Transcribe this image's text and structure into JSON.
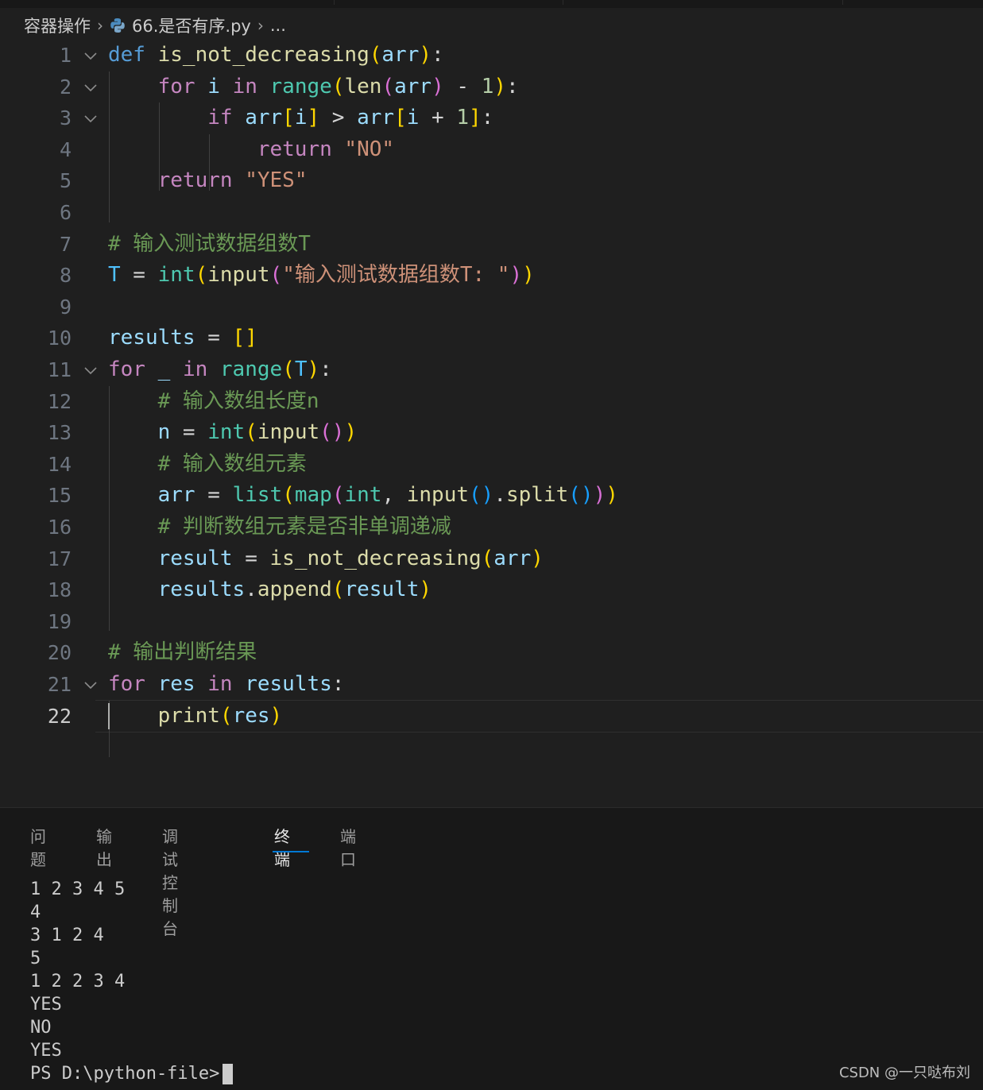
{
  "breadcrumb": {
    "folder": "容器操作",
    "file": "66.是否有序.py",
    "more": "..."
  },
  "editor": {
    "active_line": 22,
    "lines": [
      {
        "n": "1",
        "fold": true,
        "tokens": [
          [
            "kw",
            "def"
          ],
          [
            "op",
            " "
          ],
          [
            "fn",
            "is_not_decreasing"
          ],
          [
            "b1",
            "("
          ],
          [
            "var",
            "arr"
          ],
          [
            "b1",
            ")"
          ],
          [
            "op",
            ":"
          ]
        ]
      },
      {
        "n": "2",
        "fold": true,
        "tokens": [
          [
            "op",
            "    "
          ],
          [
            "ctl",
            "for"
          ],
          [
            "op",
            " "
          ],
          [
            "var",
            "i"
          ],
          [
            "op",
            " "
          ],
          [
            "ctl",
            "in"
          ],
          [
            "op",
            " "
          ],
          [
            "bi",
            "range"
          ],
          [
            "b1",
            "("
          ],
          [
            "fn",
            "len"
          ],
          [
            "b2",
            "("
          ],
          [
            "var",
            "arr"
          ],
          [
            "b2",
            ")"
          ],
          [
            "op",
            " - "
          ],
          [
            "num",
            "1"
          ],
          [
            "b1",
            ")"
          ],
          [
            "op",
            ":"
          ]
        ]
      },
      {
        "n": "3",
        "fold": true,
        "tokens": [
          [
            "op",
            "        "
          ],
          [
            "ctl",
            "if"
          ],
          [
            "op",
            " "
          ],
          [
            "var",
            "arr"
          ],
          [
            "b1",
            "["
          ],
          [
            "var",
            "i"
          ],
          [
            "b1",
            "]"
          ],
          [
            "op",
            " > "
          ],
          [
            "var",
            "arr"
          ],
          [
            "b1",
            "["
          ],
          [
            "var",
            "i"
          ],
          [
            "op",
            " + "
          ],
          [
            "num",
            "1"
          ],
          [
            "b1",
            "]"
          ],
          [
            "op",
            ":"
          ]
        ]
      },
      {
        "n": "4",
        "fold": false,
        "tokens": [
          [
            "op",
            "            "
          ],
          [
            "ctl",
            "return"
          ],
          [
            "op",
            " "
          ],
          [
            "str",
            "\"NO\""
          ]
        ]
      },
      {
        "n": "5",
        "fold": false,
        "tokens": [
          [
            "op",
            "    "
          ],
          [
            "ctl",
            "return"
          ],
          [
            "op",
            " "
          ],
          [
            "str",
            "\"YES\""
          ]
        ]
      },
      {
        "n": "6",
        "fold": false,
        "tokens": []
      },
      {
        "n": "7",
        "fold": false,
        "tokens": [
          [
            "cmt",
            "# 输入测试数据组数T"
          ]
        ]
      },
      {
        "n": "8",
        "fold": false,
        "tokens": [
          [
            "cst",
            "T"
          ],
          [
            "op",
            " = "
          ],
          [
            "bi",
            "int"
          ],
          [
            "b1",
            "("
          ],
          [
            "fn",
            "input"
          ],
          [
            "b2",
            "("
          ],
          [
            "str",
            "\"输入测试数据组数T: \""
          ],
          [
            "b2",
            ")"
          ],
          [
            "b1",
            ")"
          ]
        ]
      },
      {
        "n": "9",
        "fold": false,
        "tokens": []
      },
      {
        "n": "10",
        "fold": false,
        "tokens": [
          [
            "var",
            "results"
          ],
          [
            "op",
            " = "
          ],
          [
            "b1",
            "[]"
          ]
        ]
      },
      {
        "n": "11",
        "fold": true,
        "tokens": [
          [
            "ctl",
            "for"
          ],
          [
            "op",
            " "
          ],
          [
            "var",
            "_"
          ],
          [
            "op",
            " "
          ],
          [
            "ctl",
            "in"
          ],
          [
            "op",
            " "
          ],
          [
            "bi",
            "range"
          ],
          [
            "b1",
            "("
          ],
          [
            "cst",
            "T"
          ],
          [
            "b1",
            ")"
          ],
          [
            "op",
            ":"
          ]
        ]
      },
      {
        "n": "12",
        "fold": false,
        "tokens": [
          [
            "op",
            "    "
          ],
          [
            "cmt",
            "# 输入数组长度n"
          ]
        ]
      },
      {
        "n": "13",
        "fold": false,
        "tokens": [
          [
            "op",
            "    "
          ],
          [
            "var",
            "n"
          ],
          [
            "op",
            " = "
          ],
          [
            "bi",
            "int"
          ],
          [
            "b1",
            "("
          ],
          [
            "fn",
            "input"
          ],
          [
            "b2",
            "()"
          ],
          [
            "b1",
            ")"
          ]
        ]
      },
      {
        "n": "14",
        "fold": false,
        "tokens": [
          [
            "op",
            "    "
          ],
          [
            "cmt",
            "# 输入数组元素"
          ]
        ]
      },
      {
        "n": "15",
        "fold": false,
        "tokens": [
          [
            "op",
            "    "
          ],
          [
            "var",
            "arr"
          ],
          [
            "op",
            " = "
          ],
          [
            "bi",
            "list"
          ],
          [
            "b1",
            "("
          ],
          [
            "bi",
            "map"
          ],
          [
            "b2",
            "("
          ],
          [
            "bi",
            "int"
          ],
          [
            "op",
            ", "
          ],
          [
            "fn",
            "input"
          ],
          [
            "b3",
            "()"
          ],
          [
            "op",
            "."
          ],
          [
            "fn",
            "split"
          ],
          [
            "b3",
            "()"
          ],
          [
            "b2",
            ")"
          ],
          [
            "b1",
            ")"
          ]
        ]
      },
      {
        "n": "16",
        "fold": false,
        "tokens": [
          [
            "op",
            "    "
          ],
          [
            "cmt",
            "# 判断数组元素是否非单调递减"
          ]
        ]
      },
      {
        "n": "17",
        "fold": false,
        "tokens": [
          [
            "op",
            "    "
          ],
          [
            "var",
            "result"
          ],
          [
            "op",
            " = "
          ],
          [
            "fn",
            "is_not_decreasing"
          ],
          [
            "b1",
            "("
          ],
          [
            "var",
            "arr"
          ],
          [
            "b1",
            ")"
          ]
        ]
      },
      {
        "n": "18",
        "fold": false,
        "tokens": [
          [
            "op",
            "    "
          ],
          [
            "var",
            "results"
          ],
          [
            "op",
            "."
          ],
          [
            "fn",
            "append"
          ],
          [
            "b1",
            "("
          ],
          [
            "var",
            "result"
          ],
          [
            "b1",
            ")"
          ]
        ]
      },
      {
        "n": "19",
        "fold": false,
        "tokens": []
      },
      {
        "n": "20",
        "fold": false,
        "tokens": [
          [
            "cmt",
            "# 输出判断结果"
          ]
        ]
      },
      {
        "n": "21",
        "fold": true,
        "tokens": [
          [
            "ctl",
            "for"
          ],
          [
            "op",
            " "
          ],
          [
            "var",
            "res"
          ],
          [
            "op",
            " "
          ],
          [
            "ctl",
            "in"
          ],
          [
            "op",
            " "
          ],
          [
            "var",
            "results"
          ],
          [
            "op",
            ":"
          ]
        ]
      },
      {
        "n": "22",
        "fold": false,
        "tokens": [
          [
            "op",
            "    "
          ],
          [
            "fn",
            "print"
          ],
          [
            "b1",
            "("
          ],
          [
            "var",
            "res"
          ],
          [
            "b1",
            ")"
          ]
        ]
      }
    ]
  },
  "panel": {
    "tabs": [
      {
        "label": "问题",
        "active": false
      },
      {
        "label": "输出",
        "active": false
      },
      {
        "label": "调试控制台",
        "active": false
      },
      {
        "label": "终端",
        "active": true
      },
      {
        "label": "端口",
        "active": false
      }
    ],
    "terminal_lines": [
      "1 2 3 4 5",
      "4",
      "3 1 2 4",
      "5",
      "1 2 2 3 4",
      "YES",
      "NO",
      "YES"
    ],
    "prompt": "PS D:\\python-file>"
  },
  "watermark": "CSDN @一只哒布刘",
  "colors": {
    "editor_bg": "#1f1f1f",
    "panel_bg": "#181818",
    "accent": "#0078d4"
  }
}
